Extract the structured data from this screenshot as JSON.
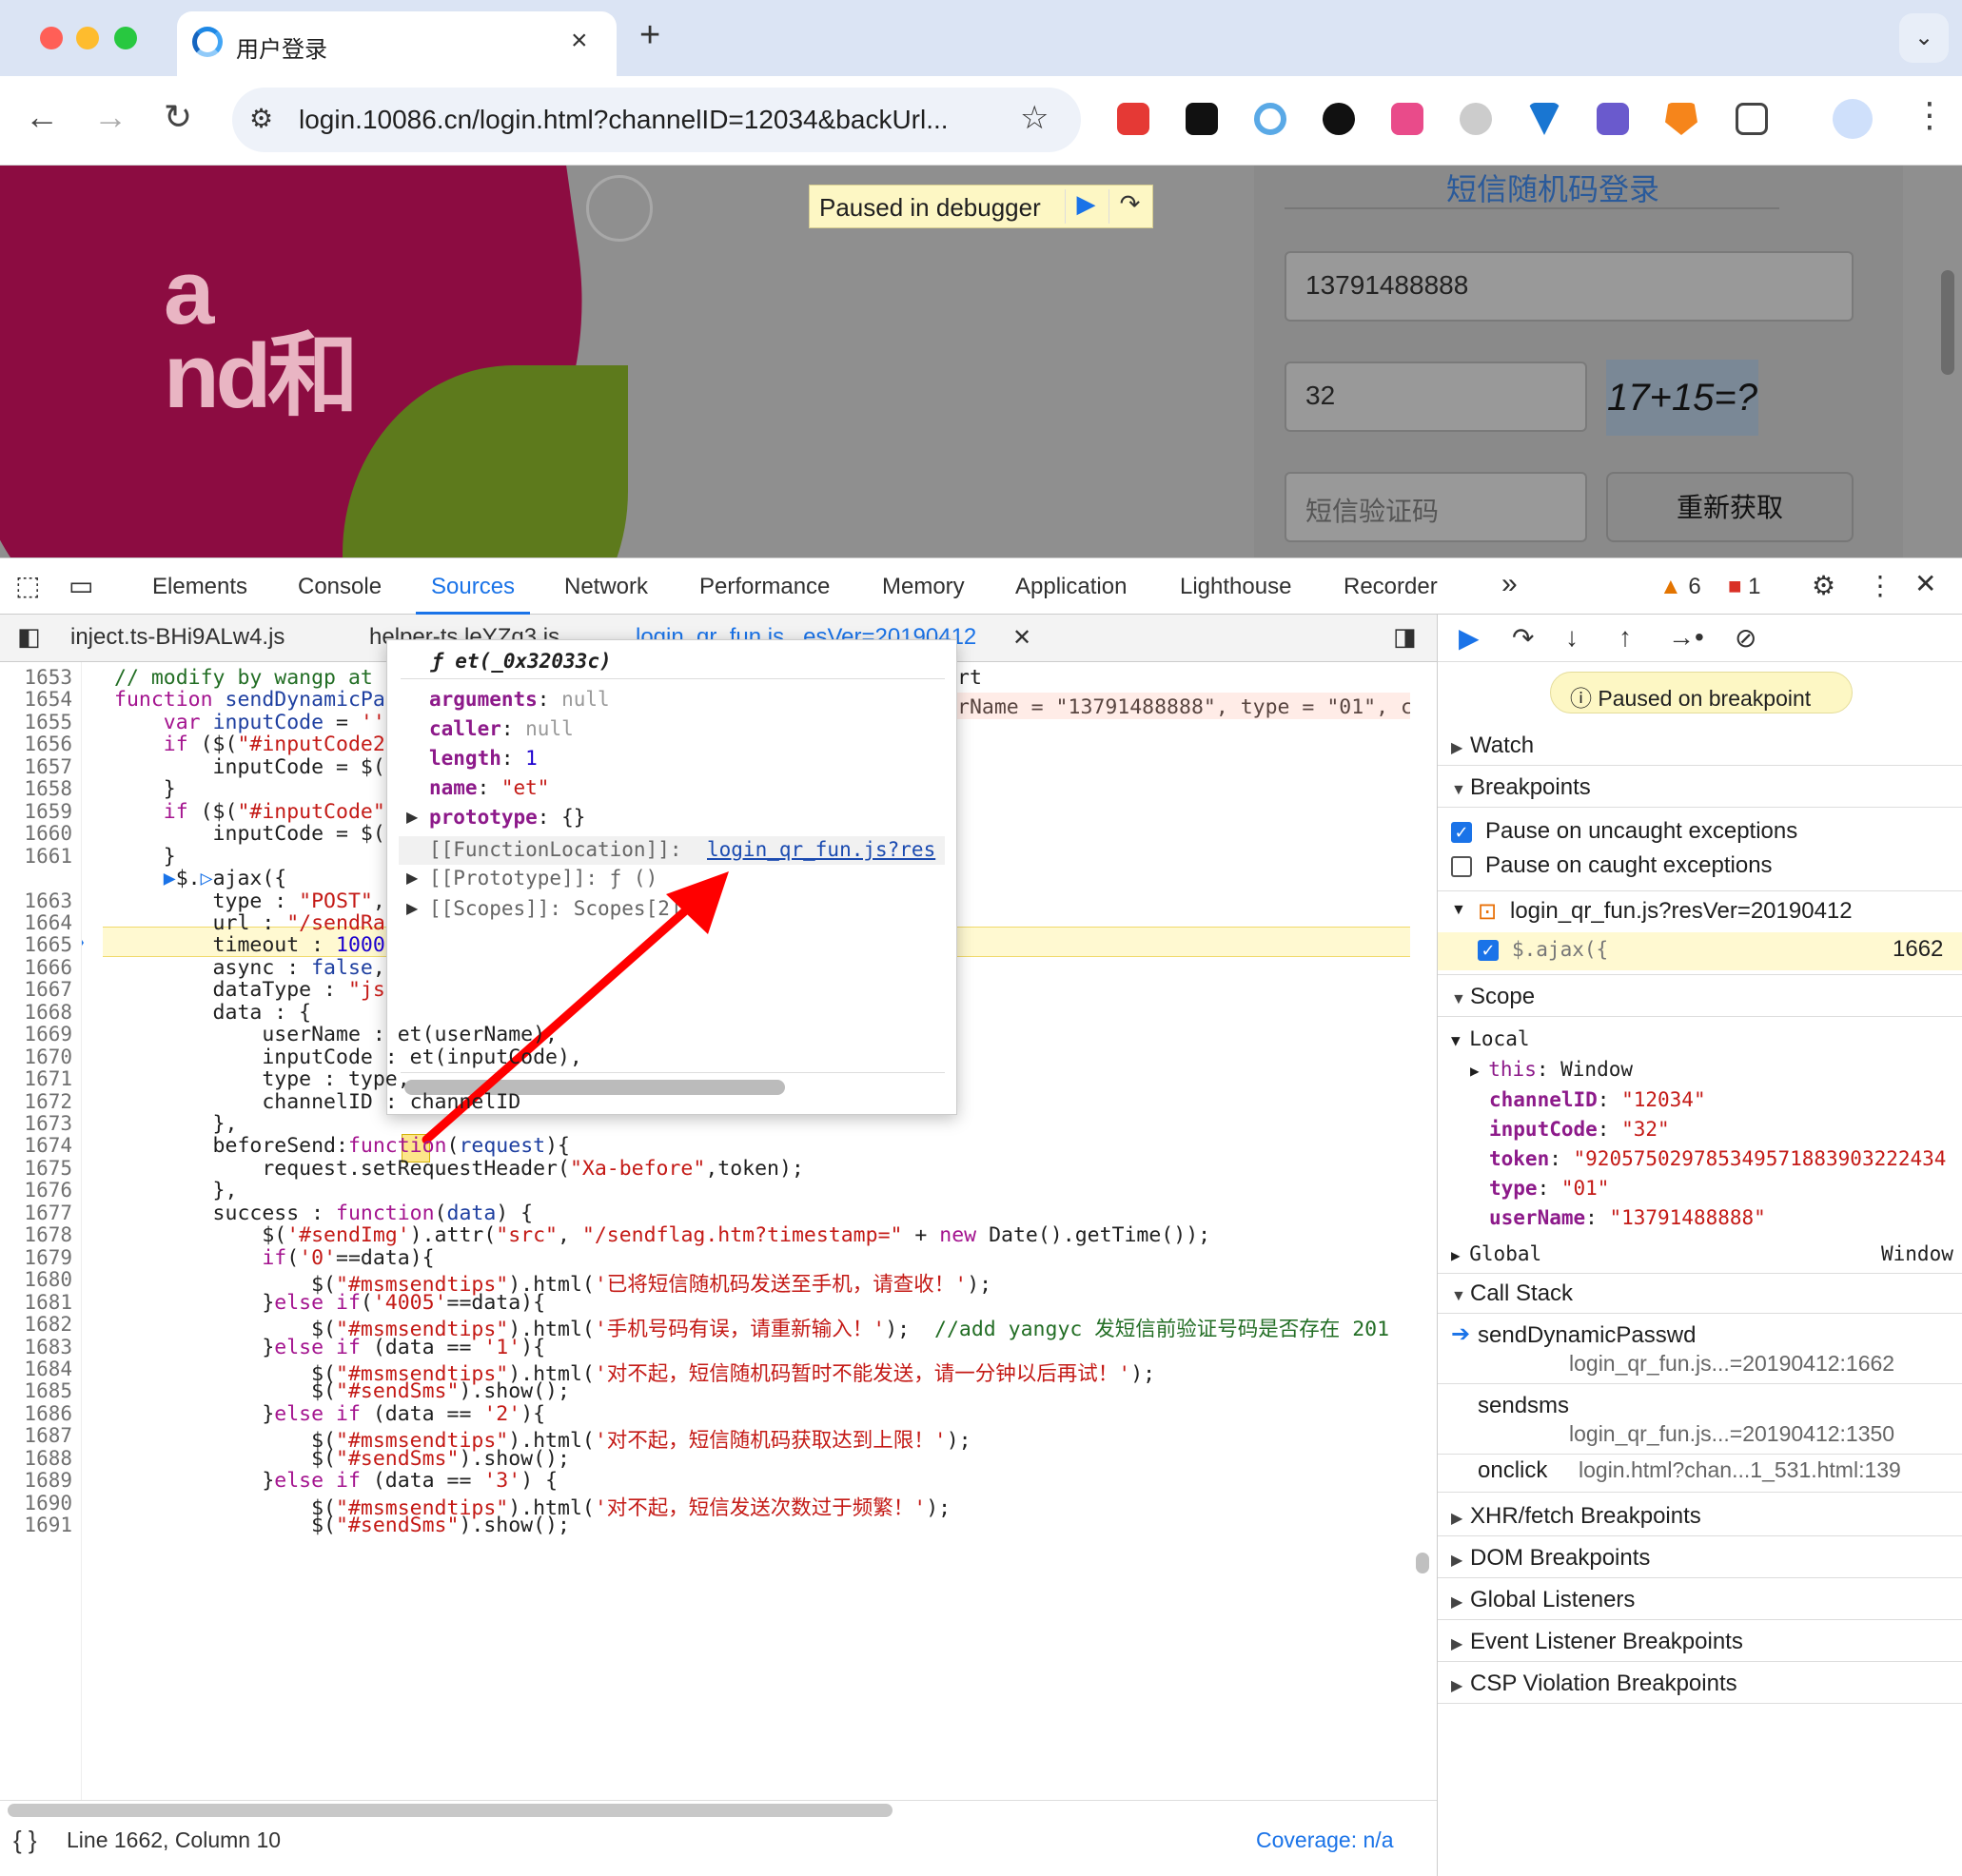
{
  "browser": {
    "tab_title": "用户登录",
    "tab_close": "×",
    "new_tab": "+",
    "url": "login.10086.cn/login.html?channelID=12034&backUrl..."
  },
  "page": {
    "logo_text_top": "a",
    "logo_text_bottom": "nd和",
    "paused_banner": "Paused in debugger",
    "form_title": "短信随机码登录",
    "phone_value": "13791488888",
    "code_value": "32",
    "captcha_text": "17+15=?",
    "sms_placeholder": "短信验证码",
    "resend_label": "重新获取"
  },
  "devtools": {
    "tabs": [
      "Elements",
      "Console",
      "Sources",
      "Network",
      "Performance",
      "Memory",
      "Application",
      "Lighthouse",
      "Recorder"
    ],
    "more": "»",
    "warnings": "6",
    "errors": "1",
    "editor_tabs": [
      "inject.ts-BHi9ALw4.js",
      "helper-ts.leYZq3.js",
      "login_qr_fun.js...esVer=20190412"
    ],
    "status_position": "Line 1662, Column 10",
    "coverage": "Coverage: n/a"
  },
  "code": {
    "line_numbers": [
      "1653",
      "1654",
      "1655",
      "1656",
      "1657",
      "1658",
      "1659",
      "1660",
      "1661",
      "1662",
      "1663",
      "1664",
      "1665",
      "1666",
      "1667",
      "1668",
      "1669",
      "1670",
      "1671",
      "1672",
      "1673",
      "1674",
      "1675",
      "1676",
      "1677",
      "1678",
      "1679",
      "1680",
      "1681",
      "1682",
      "1683",
      "1684",
      "1685",
      "1686",
      "1687",
      "1688",
      "1689",
      "1690",
      "1691"
    ],
    "current_line": "1662",
    "inline_values": "rt\nrName = \"13791488888\", type = \"01\", c"
  },
  "popover": {
    "title": "ƒ et(_0x32033c)",
    "rows": [
      {
        "key": "arguments",
        "value": "null"
      },
      {
        "key": "caller",
        "value": "null"
      },
      {
        "key": "length",
        "value": "1"
      },
      {
        "key": "name",
        "value": "\"et\""
      },
      {
        "key": "prototype",
        "value": "{}"
      }
    ],
    "function_location_key": "[[FunctionLocation]]:",
    "function_location_link": "login_qr_fun.js?res",
    "prototype_internal": "[[Prototype]]: ƒ ()",
    "scopes": "[[Scopes]]: Scopes[2]"
  },
  "debugger": {
    "paused_badge": "Paused on breakpoint",
    "watch": "Watch",
    "breakpoints": "Breakpoints",
    "pause_uncaught": "Pause on uncaught exceptions",
    "pause_caught": "Pause on caught exceptions",
    "bp_file": "login_qr_fun.js?resVer=20190412",
    "bp_code": "$.ajax({",
    "bp_line": "1662",
    "scope": "Scope",
    "local": "Local",
    "this_key": "this",
    "this_val": "Window",
    "locals": [
      {
        "key": "channelID",
        "value": "\"12034\""
      },
      {
        "key": "inputCode",
        "value": "\"32\""
      },
      {
        "key": "token",
        "value": "\"920575029785349571883903222434"
      },
      {
        "key": "type",
        "value": "\"01\""
      },
      {
        "key": "userName",
        "value": "\"13791488888\""
      }
    ],
    "global": "Global",
    "global_val": "Window",
    "call_stack": "Call Stack",
    "frames": [
      {
        "name": "sendDynamicPasswd",
        "loc": "login_qr_fun.js...=20190412:1662"
      },
      {
        "name": "sendsms",
        "loc": "login_qr_fun.js...=20190412:1350"
      },
      {
        "name": "onclick",
        "loc": "login.html?chan...1_531.html:139"
      }
    ],
    "sections": [
      "XHR/fetch Breakpoints",
      "DOM Breakpoints",
      "Global Listeners",
      "Event Listener Breakpoints",
      "CSP Violation Breakpoints"
    ]
  }
}
